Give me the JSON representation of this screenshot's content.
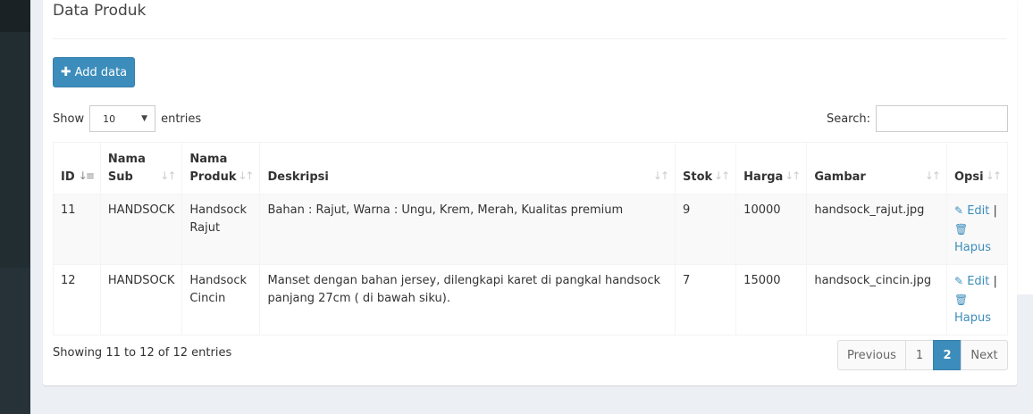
{
  "box": {
    "title": "Data Produk"
  },
  "toolbar": {
    "add_label": "Add data",
    "add_icon": "plus-icon"
  },
  "length_menu": {
    "show_label": "Show",
    "selected": "10",
    "entries_label": "entries"
  },
  "search": {
    "label": "Search:",
    "value": ""
  },
  "table": {
    "headers": [
      "ID",
      "Nama Sub",
      "Nama Produk",
      "Deskripsi",
      "Stok",
      "Harga",
      "Gambar",
      "Opsi"
    ],
    "rows": [
      {
        "id": "11",
        "sub": "HANDSOCK",
        "produk": "Handsock Rajut",
        "deskripsi": "Bahan : Rajut, Warna : Ungu, Krem, Merah, Kualitas premium",
        "stok": "9",
        "harga": "10000",
        "gambar": "handsock_rajut.jpg"
      },
      {
        "id": "12",
        "sub": "HANDSOCK",
        "produk": "Handsock Cincin",
        "deskripsi": "Manset dengan bahan jersey, dilengkapi karet di pangkal handsock panjang 27cm ( di bawah siku).",
        "stok": "7",
        "harga": "15000",
        "gambar": "handsock_cincin.jpg"
      }
    ],
    "actions": {
      "edit": "Edit",
      "separator": "|",
      "delete": "Hapus"
    }
  },
  "info": "Showing 11 to 12 of 12 entries",
  "pagination": {
    "previous": "Previous",
    "pages": [
      "1",
      "2"
    ],
    "active_page": "2",
    "next": "Next"
  },
  "colors": {
    "primary": "#3c8dbc",
    "sidebar": "#222d32",
    "background": "#ecf0f5"
  }
}
